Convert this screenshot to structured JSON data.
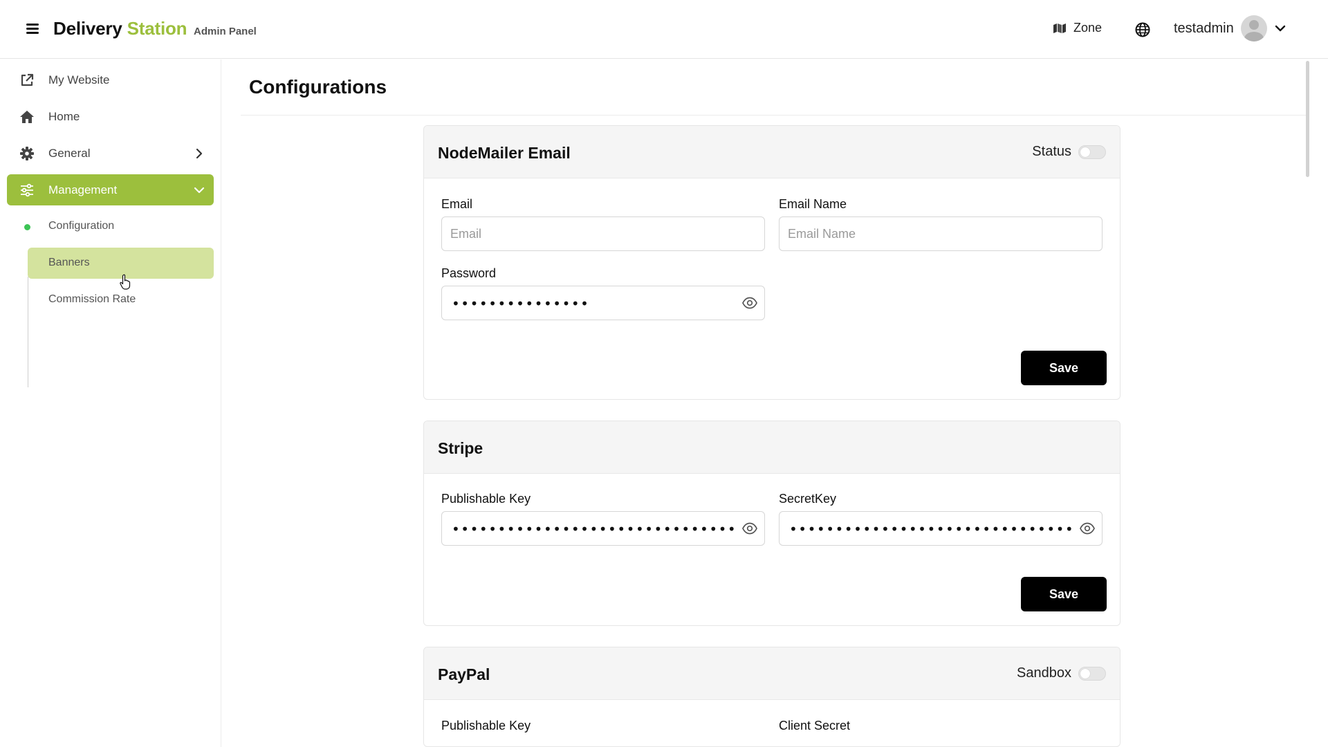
{
  "header": {
    "brand_part1": "Delivery",
    "brand_part2": "Station",
    "brand_subtitle": "Admin Panel",
    "zone_label": "Zone",
    "username": "testadmin",
    "brand_accent_color": "#9cbf3d"
  },
  "sidebar": {
    "items": [
      {
        "label": "My Website",
        "icon": "external-link-icon"
      },
      {
        "label": "Home",
        "icon": "home-icon"
      },
      {
        "label": "General",
        "icon": "gear-icon"
      },
      {
        "label": "Management",
        "icon": "sliders-icon"
      }
    ],
    "sub_items": [
      {
        "label": "Configuration"
      },
      {
        "label": "Banners"
      },
      {
        "label": "Commission Rate"
      }
    ]
  },
  "main": {
    "page_title": "Configurations",
    "nodemailer": {
      "title": "NodeMailer Email",
      "status_label": "Status",
      "email_label": "Email",
      "email_placeholder": "Email",
      "email_name_label": "Email Name",
      "email_name_placeholder": "Email Name",
      "password_label": "Password",
      "password_mask": "•••••••••••••••",
      "save_label": "Save"
    },
    "stripe": {
      "title": "Stripe",
      "publishable_label": "Publishable Key",
      "publishable_mask": "••••••••••••••••••••••••••••••••••••••••••",
      "secret_label": "SecretKey",
      "secret_mask": "••••••••••••••••••••••••••••••••••••••••••",
      "save_label": "Save"
    },
    "paypal": {
      "title": "PayPal",
      "sandbox_label": "Sandbox",
      "publishable_label": "Publishable Key",
      "client_secret_label": "Client Secret"
    }
  }
}
